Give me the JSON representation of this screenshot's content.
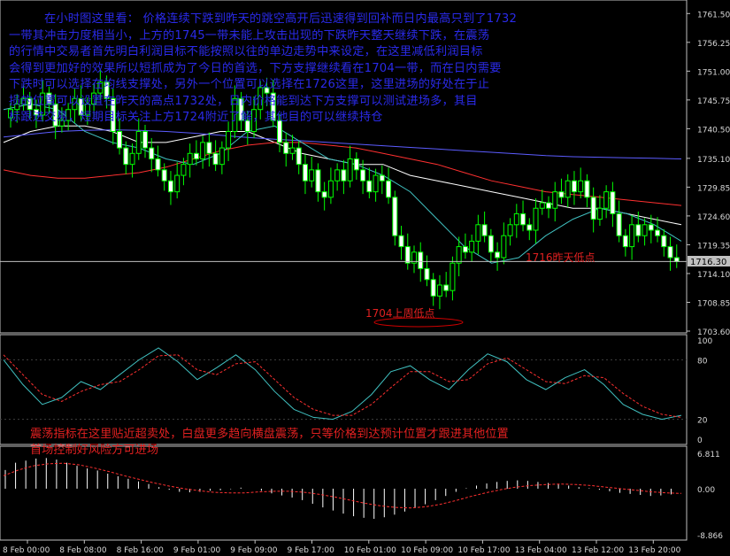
{
  "commentary": {
    "main": [
      "在小时图这里看：  价格连续下跌到昨天的跳空高开后迅速得到回补而日内最高只到了1732",
      "一带其冲击力度相当小，上方的1745一带未能上攻击出现的下跌昨天整天继续下跌，在震荡",
      "的行情中交易者首先明白利润目标不能按照以往的单边走势中来设定，在这里减低利润目标",
      "会得到更加好的效果所以短抓成为了今日的首选，下方支撑继续看在1704一带，而在日内需要",
      "下跌时可以选择在均线支撑处，另外一个位置可以选择在1726这里，这里进场的好处在于止",
      "损的位置可以设置在昨天的高点1732处，日内价格能到达下方支撑可以测试进场多，其目",
      "标跟进交易，短期目标关注上方1724附近了解，其他目的可以继续持仓"
    ],
    "oscillator": [
      "震荡指标在这里贴近超卖处，白盘更多趋向横盘震荡，只等价格到达预计位置才跟进其他位置",
      "首场控制好风险方可进场"
    ]
  },
  "annotations": {
    "last_week_low": "1704上周低点",
    "yesterday_low": "1716昨天低点"
  },
  "chart_data": {
    "type": "candlestick",
    "price_axis": {
      "min": 1703.6,
      "max": 1763.0,
      "ticks": [
        "1761.50",
        "1756.25",
        "1751.00",
        "1745.75",
        "1740.50",
        "1735.10",
        "1729.85",
        "1724.60",
        "1719.35",
        "1714.10",
        "1708.85",
        "1703.60"
      ]
    },
    "current_price": 1716.3,
    "current_price_label": "1716.30",
    "time_labels": [
      "8 Feb 00:00",
      "8 Feb 08:00",
      "8 Feb 16:00",
      "9 Feb 01:00",
      "9 Feb 09:00",
      "9 Feb 17:00",
      "10 Feb 01:00",
      "10 Feb 09:00",
      "10 Feb 17:00",
      "13 Feb 04:00",
      "13 Feb 12:00",
      "13 Feb 20:00"
    ],
    "candles_close": [
      1744,
      1745,
      1746,
      1744,
      1743,
      1747,
      1745,
      1741,
      1742,
      1744,
      1746,
      1743,
      1745,
      1747,
      1749,
      1746,
      1740,
      1737,
      1734,
      1736,
      1740,
      1737,
      1735,
      1733,
      1731,
      1729,
      1732,
      1734,
      1736,
      1735,
      1738,
      1736,
      1734,
      1737,
      1740,
      1746,
      1742,
      1740,
      1744,
      1748,
      1747,
      1742,
      1738,
      1736,
      1737,
      1734,
      1731,
      1733,
      1729,
      1728,
      1731,
      1733,
      1731,
      1735,
      1733,
      1731,
      1729,
      1732,
      1731,
      1728,
      1721,
      1719,
      1716,
      1718,
      1715,
      1713,
      1710,
      1712,
      1711,
      1716,
      1719,
      1718,
      1720,
      1723,
      1721,
      1718,
      1717,
      1721,
      1723,
      1725,
      1723,
      1722,
      1726,
      1727,
      1726,
      1729,
      1728,
      1731,
      1729,
      1731,
      1728,
      1724,
      1726,
      1729,
      1725,
      1721,
      1719,
      1723,
      1721,
      1723,
      1722,
      1721,
      1719,
      1717,
      1716.3
    ],
    "moving_averages": [
      {
        "color": "#ffffff",
        "values": [
          1738,
          1740,
          1741,
          1741,
          1740,
          1738,
          1738,
          1739,
          1740,
          1740,
          1738,
          1736,
          1735,
          1734,
          1734,
          1732,
          1731,
          1730,
          1729,
          1728,
          1727,
          1726,
          1726,
          1725,
          1724,
          1723
        ]
      },
      {
        "color": "#5c5cff",
        "values": [
          1739,
          1739.5,
          1740,
          1740.2,
          1740.3,
          1740.2,
          1740,
          1739.7,
          1739.3,
          1738.9,
          1738.6,
          1738.3,
          1738,
          1737.7,
          1737.4,
          1737.1,
          1736.8,
          1736.5,
          1736.2,
          1735.9,
          1735.6,
          1735.4,
          1735.3,
          1735.2,
          1735.1,
          1735
        ]
      },
      {
        "color": "#ff3030",
        "values": [
          1733,
          1732,
          1731.5,
          1731.5,
          1732,
          1732.5,
          1733.5,
          1735,
          1736.5,
          1737.5,
          1738,
          1738,
          1737.5,
          1737,
          1736,
          1735,
          1734,
          1732.5,
          1731,
          1730,
          1729,
          1728.5,
          1728,
          1727.5,
          1727,
          1726.5
        ]
      },
      {
        "color": "#40c0c0",
        "values": [
          1744,
          1745,
          1744,
          1740,
          1738,
          1737,
          1735,
          1734,
          1736,
          1740,
          1741,
          1738,
          1735,
          1734,
          1732,
          1729,
          1724,
          1719,
          1716,
          1717,
          1721,
          1724,
          1726,
          1725,
          1723,
          1720
        ]
      }
    ],
    "stochastic": {
      "levels": [
        100,
        80,
        20,
        0
      ],
      "k_color": "#40c0c0",
      "d_color": "#ff3030",
      "k_values": [
        80,
        55,
        35,
        42,
        58,
        50,
        65,
        80,
        92,
        78,
        60,
        72,
        85,
        70,
        48,
        30,
        22,
        20,
        28,
        45,
        68,
        74,
        60,
        50,
        70,
        86,
        78,
        60,
        50,
        62,
        70,
        55,
        35,
        25,
        20,
        24
      ],
      "d_values": [
        85,
        65,
        45,
        38,
        48,
        55,
        58,
        70,
        84,
        85,
        70,
        65,
        76,
        78,
        60,
        42,
        30,
        24,
        24,
        35,
        52,
        68,
        68,
        58,
        60,
        76,
        82,
        70,
        58,
        56,
        64,
        62,
        46,
        33,
        25,
        22
      ]
    },
    "macd": {
      "axis_labels": [
        "6.811",
        "0.00",
        "-8.866"
      ],
      "signal_color": "#ff3030",
      "histogram_color": "#ffffff",
      "histogram": [
        3.6,
        5.0,
        5.4,
        5.8,
        5.9,
        5.6,
        5.0,
        4.4,
        3.9,
        3.5,
        2.9,
        2.4,
        1.9,
        1.4,
        0.9,
        0.3,
        -0.2,
        -0.6,
        -0.7,
        -0.6,
        -0.4,
        -0.3,
        -0.1,
        0.2,
        0.0,
        -0.4,
        -0.9,
        -1.3,
        -1.7,
        -2.2,
        -2.9,
        -3.6,
        -4.2,
        -4.8,
        -5.3,
        -5.6,
        -5.8,
        -5.5,
        -5.0,
        -4.4,
        -3.7,
        -3.0,
        -2.2,
        -1.4,
        -0.6,
        0.1,
        0.6,
        1.0,
        1.3,
        1.5,
        1.6,
        1.5,
        1.3,
        1.1,
        0.9,
        0.6,
        0.3,
        0.1,
        -0.2,
        -0.5,
        -0.8,
        -1.0,
        -1.2,
        -1.4,
        -1.3,
        -1.1
      ],
      "signal": [
        2.5,
        3.6,
        4.4,
        4.8,
        4.9,
        4.6,
        4.0,
        3.3,
        2.5,
        1.8,
        1.1,
        0.5,
        0.0,
        -0.4,
        -0.7,
        -0.8,
        -0.8,
        -0.6,
        -0.5,
        -0.5,
        -0.7,
        -1.1,
        -1.6,
        -2.2,
        -2.8,
        -3.3,
        -3.6,
        -3.7,
        -3.5,
        -3.0,
        -2.3,
        -1.5,
        -0.8,
        -0.2,
        0.3,
        0.6,
        0.8,
        0.9,
        0.8,
        0.6,
        0.3,
        0.0,
        -0.3,
        -0.6,
        -0.8,
        -0.9
      ]
    }
  }
}
